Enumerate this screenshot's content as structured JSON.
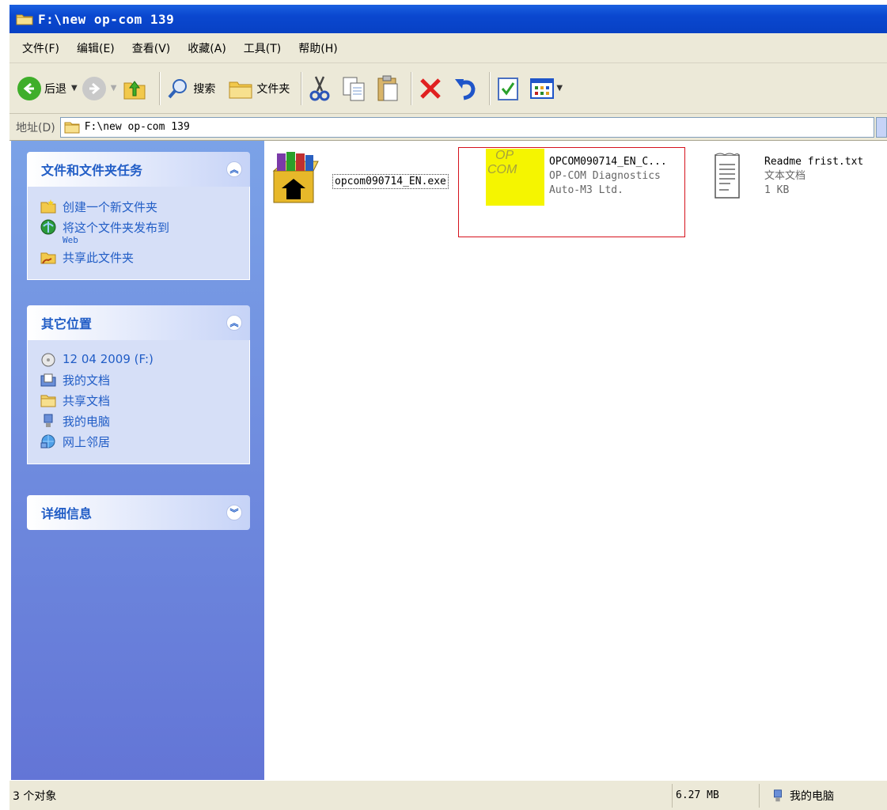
{
  "window": {
    "title": "F:\\new op-com 139"
  },
  "menu": [
    "文件(F)",
    "编辑(E)",
    "查看(V)",
    "收藏(A)",
    "工具(T)",
    "帮助(H)"
  ],
  "toolbar": {
    "back_label": "后退",
    "search_label": "搜索",
    "folders_label": "文件夹"
  },
  "address": {
    "label": "地址(D)",
    "value": "F:\\new op-com 139"
  },
  "tasks_panel": {
    "title": "文件和文件夹任务",
    "items": [
      {
        "label": "创建一个新文件夹"
      },
      {
        "label": "将这个文件夹发布到",
        "sub": "Web"
      },
      {
        "label": "共享此文件夹"
      }
    ]
  },
  "places_panel": {
    "title": "其它位置",
    "items": [
      {
        "label": "12 04 2009 (F:)"
      },
      {
        "label": "我的文档"
      },
      {
        "label": "共享文档"
      },
      {
        "label": "我的电脑"
      },
      {
        "label": "网上邻居"
      }
    ]
  },
  "details_panel": {
    "title": "详细信息"
  },
  "files": [
    {
      "name": "opcom090714_EN.exe"
    },
    {
      "name": "OPCOM090714_EN_C...",
      "line2": "OP-COM Diagnostics",
      "line3": "Auto-M3 Ltd.",
      "icon_text_1": "OP",
      "icon_text_2": "COM"
    },
    {
      "name": "Readme frist.txt",
      "line2": "文本文档",
      "line3": "1 KB"
    }
  ],
  "status": {
    "count": "3 个对象",
    "size": "6.27 MB",
    "location": "我的电脑"
  },
  "colors": {
    "title_blue": "#0a47cf",
    "task_pane": "#6375d6",
    "link_blue": "#215dc6",
    "highlight_red": "#d6121d",
    "opcom_yellow": "#f5f500"
  }
}
